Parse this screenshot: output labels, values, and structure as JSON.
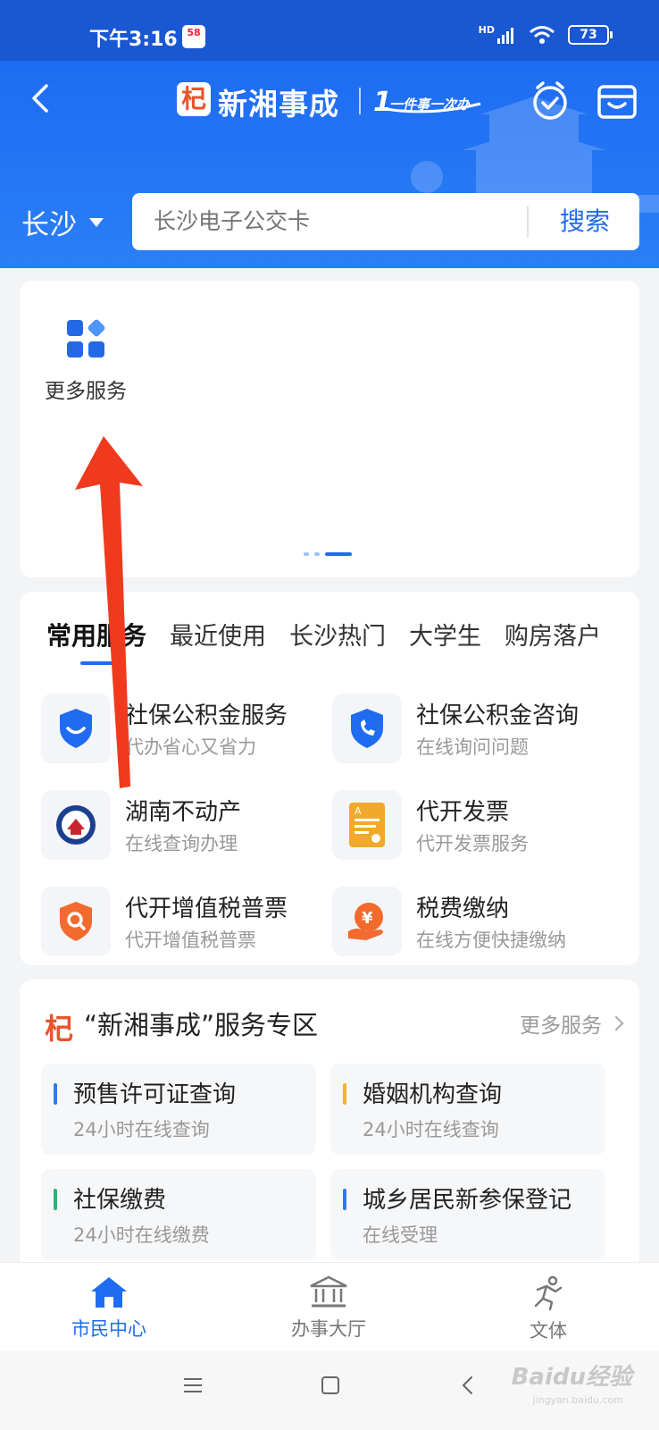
{
  "status_bar": {
    "time": "下午3:16",
    "app_badge": "58",
    "network": "HD",
    "battery": "73"
  },
  "header": {
    "logo_char": "杞",
    "app_name": "新湘事成",
    "slogan": "一件事一次办",
    "city": "长沙",
    "search_placeholder": "长沙电子公交卡",
    "search_button": "搜索"
  },
  "top_card": {
    "more_services_label": "更多服务",
    "pager_current": 3,
    "pager_total": 3
  },
  "service_tabs": {
    "tabs": [
      {
        "label": "常用服务",
        "active": true
      },
      {
        "label": "最近使用",
        "active": false
      },
      {
        "label": "长沙热门",
        "active": false
      },
      {
        "label": "大学生",
        "active": false
      },
      {
        "label": "购房落户",
        "active": false
      }
    ],
    "items": [
      {
        "title": "社保公积金服务",
        "subtitle": "代办省心又省力",
        "icon": "shield-smile-icon"
      },
      {
        "title": "社保公积金咨询",
        "subtitle": "在线询问问题",
        "icon": "shield-phone-icon"
      },
      {
        "title": "湖南不动产",
        "subtitle": "在线查询办理",
        "icon": "property-seal-icon"
      },
      {
        "title": "代开发票",
        "subtitle": "代开发票服务",
        "icon": "invoice-icon"
      },
      {
        "title": "代开增值税普票",
        "subtitle": "代开增值税普票",
        "icon": "shield-search-icon"
      },
      {
        "title": "税费缴纳",
        "subtitle": "在线方便快捷缴纳",
        "icon": "yuan-hand-icon"
      }
    ]
  },
  "zone": {
    "logo_char": "杞",
    "title": "“新湘事成”服务专区",
    "more_label": "更多服务",
    "items": [
      {
        "title": "预售许可证查询",
        "subtitle": "24小时在线查询",
        "bar_color": "#2f7af0"
      },
      {
        "title": "婚姻机构查询",
        "subtitle": "24小时在线查询",
        "bar_color": "#f0b429"
      },
      {
        "title": "社保缴费",
        "subtitle": "24小时在线缴费",
        "bar_color": "#2ab27b"
      },
      {
        "title": "城乡居民新参保登记",
        "subtitle": "在线受理",
        "bar_color": "#2f7af0"
      }
    ]
  },
  "bottom_nav": {
    "items": [
      {
        "label": "市民中心",
        "icon": "home-icon",
        "active": true
      },
      {
        "label": "办事大厅",
        "icon": "hall-icon",
        "active": false
      },
      {
        "label": "文体",
        "icon": "runner-icon",
        "active": false
      }
    ]
  },
  "watermark": {
    "text": "Baidu经验",
    "sub": "jingyan.baidu.com"
  },
  "colors": {
    "brand_blue": "#1f6cf0",
    "header_blue": "#1e6cf2",
    "logo_red": "#e8542c",
    "arrow_red": "#f03a1e"
  }
}
